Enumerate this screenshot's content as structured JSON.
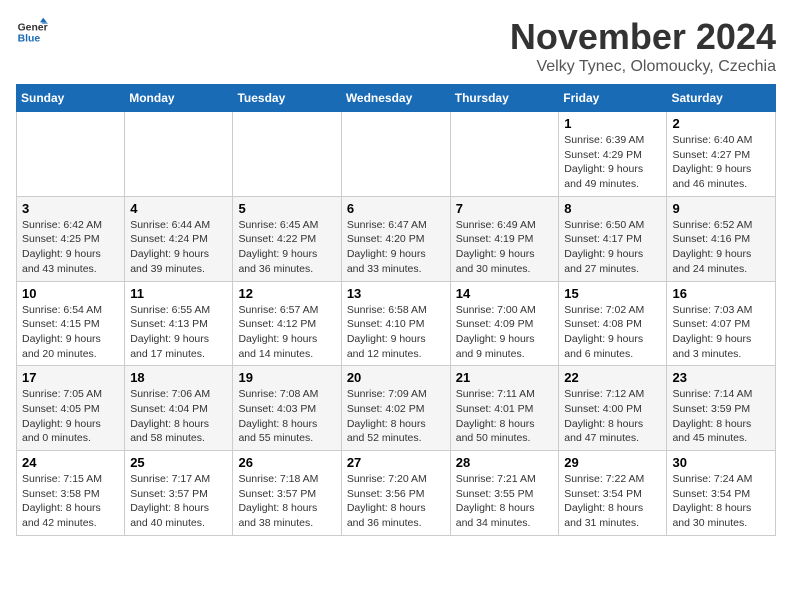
{
  "logo": {
    "line1": "General",
    "line2": "Blue"
  },
  "title": "November 2024",
  "subtitle": "Velky Tynec, Olomoucky, Czechia",
  "days_of_week": [
    "Sunday",
    "Monday",
    "Tuesday",
    "Wednesday",
    "Thursday",
    "Friday",
    "Saturday"
  ],
  "weeks": [
    [
      {
        "day": "",
        "sunrise": "",
        "sunset": "",
        "daylight": ""
      },
      {
        "day": "",
        "sunrise": "",
        "sunset": "",
        "daylight": ""
      },
      {
        "day": "",
        "sunrise": "",
        "sunset": "",
        "daylight": ""
      },
      {
        "day": "",
        "sunrise": "",
        "sunset": "",
        "daylight": ""
      },
      {
        "day": "",
        "sunrise": "",
        "sunset": "",
        "daylight": ""
      },
      {
        "day": "1",
        "sunrise": "Sunrise: 6:39 AM",
        "sunset": "Sunset: 4:29 PM",
        "daylight": "Daylight: 9 hours and 49 minutes."
      },
      {
        "day": "2",
        "sunrise": "Sunrise: 6:40 AM",
        "sunset": "Sunset: 4:27 PM",
        "daylight": "Daylight: 9 hours and 46 minutes."
      }
    ],
    [
      {
        "day": "3",
        "sunrise": "Sunrise: 6:42 AM",
        "sunset": "Sunset: 4:25 PM",
        "daylight": "Daylight: 9 hours and 43 minutes."
      },
      {
        "day": "4",
        "sunrise": "Sunrise: 6:44 AM",
        "sunset": "Sunset: 4:24 PM",
        "daylight": "Daylight: 9 hours and 39 minutes."
      },
      {
        "day": "5",
        "sunrise": "Sunrise: 6:45 AM",
        "sunset": "Sunset: 4:22 PM",
        "daylight": "Daylight: 9 hours and 36 minutes."
      },
      {
        "day": "6",
        "sunrise": "Sunrise: 6:47 AM",
        "sunset": "Sunset: 4:20 PM",
        "daylight": "Daylight: 9 hours and 33 minutes."
      },
      {
        "day": "7",
        "sunrise": "Sunrise: 6:49 AM",
        "sunset": "Sunset: 4:19 PM",
        "daylight": "Daylight: 9 hours and 30 minutes."
      },
      {
        "day": "8",
        "sunrise": "Sunrise: 6:50 AM",
        "sunset": "Sunset: 4:17 PM",
        "daylight": "Daylight: 9 hours and 27 minutes."
      },
      {
        "day": "9",
        "sunrise": "Sunrise: 6:52 AM",
        "sunset": "Sunset: 4:16 PM",
        "daylight": "Daylight: 9 hours and 24 minutes."
      }
    ],
    [
      {
        "day": "10",
        "sunrise": "Sunrise: 6:54 AM",
        "sunset": "Sunset: 4:15 PM",
        "daylight": "Daylight: 9 hours and 20 minutes."
      },
      {
        "day": "11",
        "sunrise": "Sunrise: 6:55 AM",
        "sunset": "Sunset: 4:13 PM",
        "daylight": "Daylight: 9 hours and 17 minutes."
      },
      {
        "day": "12",
        "sunrise": "Sunrise: 6:57 AM",
        "sunset": "Sunset: 4:12 PM",
        "daylight": "Daylight: 9 hours and 14 minutes."
      },
      {
        "day": "13",
        "sunrise": "Sunrise: 6:58 AM",
        "sunset": "Sunset: 4:10 PM",
        "daylight": "Daylight: 9 hours and 12 minutes."
      },
      {
        "day": "14",
        "sunrise": "Sunrise: 7:00 AM",
        "sunset": "Sunset: 4:09 PM",
        "daylight": "Daylight: 9 hours and 9 minutes."
      },
      {
        "day": "15",
        "sunrise": "Sunrise: 7:02 AM",
        "sunset": "Sunset: 4:08 PM",
        "daylight": "Daylight: 9 hours and 6 minutes."
      },
      {
        "day": "16",
        "sunrise": "Sunrise: 7:03 AM",
        "sunset": "Sunset: 4:07 PM",
        "daylight": "Daylight: 9 hours and 3 minutes."
      }
    ],
    [
      {
        "day": "17",
        "sunrise": "Sunrise: 7:05 AM",
        "sunset": "Sunset: 4:05 PM",
        "daylight": "Daylight: 9 hours and 0 minutes."
      },
      {
        "day": "18",
        "sunrise": "Sunrise: 7:06 AM",
        "sunset": "Sunset: 4:04 PM",
        "daylight": "Daylight: 8 hours and 58 minutes."
      },
      {
        "day": "19",
        "sunrise": "Sunrise: 7:08 AM",
        "sunset": "Sunset: 4:03 PM",
        "daylight": "Daylight: 8 hours and 55 minutes."
      },
      {
        "day": "20",
        "sunrise": "Sunrise: 7:09 AM",
        "sunset": "Sunset: 4:02 PM",
        "daylight": "Daylight: 8 hours and 52 minutes."
      },
      {
        "day": "21",
        "sunrise": "Sunrise: 7:11 AM",
        "sunset": "Sunset: 4:01 PM",
        "daylight": "Daylight: 8 hours and 50 minutes."
      },
      {
        "day": "22",
        "sunrise": "Sunrise: 7:12 AM",
        "sunset": "Sunset: 4:00 PM",
        "daylight": "Daylight: 8 hours and 47 minutes."
      },
      {
        "day": "23",
        "sunrise": "Sunrise: 7:14 AM",
        "sunset": "Sunset: 3:59 PM",
        "daylight": "Daylight: 8 hours and 45 minutes."
      }
    ],
    [
      {
        "day": "24",
        "sunrise": "Sunrise: 7:15 AM",
        "sunset": "Sunset: 3:58 PM",
        "daylight": "Daylight: 8 hours and 42 minutes."
      },
      {
        "day": "25",
        "sunrise": "Sunrise: 7:17 AM",
        "sunset": "Sunset: 3:57 PM",
        "daylight": "Daylight: 8 hours and 40 minutes."
      },
      {
        "day": "26",
        "sunrise": "Sunrise: 7:18 AM",
        "sunset": "Sunset: 3:57 PM",
        "daylight": "Daylight: 8 hours and 38 minutes."
      },
      {
        "day": "27",
        "sunrise": "Sunrise: 7:20 AM",
        "sunset": "Sunset: 3:56 PM",
        "daylight": "Daylight: 8 hours and 36 minutes."
      },
      {
        "day": "28",
        "sunrise": "Sunrise: 7:21 AM",
        "sunset": "Sunset: 3:55 PM",
        "daylight": "Daylight: 8 hours and 34 minutes."
      },
      {
        "day": "29",
        "sunrise": "Sunrise: 7:22 AM",
        "sunset": "Sunset: 3:54 PM",
        "daylight": "Daylight: 8 hours and 31 minutes."
      },
      {
        "day": "30",
        "sunrise": "Sunrise: 7:24 AM",
        "sunset": "Sunset: 3:54 PM",
        "daylight": "Daylight: 8 hours and 30 minutes."
      }
    ]
  ]
}
